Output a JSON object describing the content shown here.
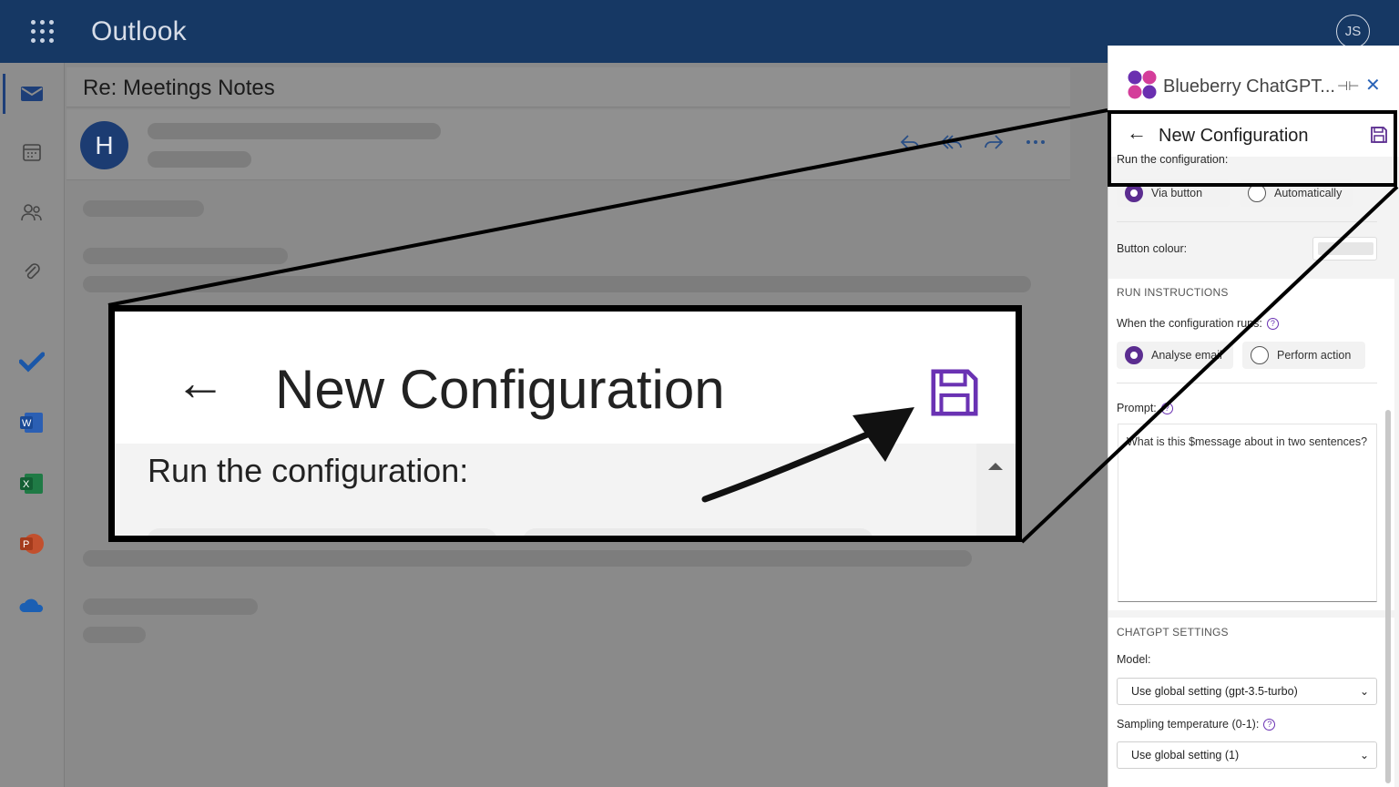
{
  "app": {
    "brand": "Outlook",
    "user_initials": "JS"
  },
  "mail": {
    "subject": "Re: Meetings Notes",
    "sender_initial": "H"
  },
  "panel": {
    "title": "Blueberry ChatGPT...",
    "config_title": "New Configuration",
    "run_label": "Run the configuration:",
    "run_options": [
      "Via button",
      "Automatically"
    ],
    "button_colour_label": "Button colour:",
    "run_instructions_title": "RUN INSTRUCTIONS",
    "when_runs_label": "When the configuration runs:",
    "when_options": [
      "Analyse email",
      "Perform action"
    ],
    "prompt_label": "Prompt:",
    "prompt_value": "What is this $message about in two sentences?",
    "chatgpt_settings_title": "CHATGPT SETTINGS",
    "model_label": "Model:",
    "model_value": "Use global setting (gpt-3.5-turbo)",
    "temperature_label": "Sampling temperature (0-1):",
    "temperature_value": "Use global setting (1)"
  },
  "zoom": {
    "config_title": "New Configuration",
    "run_label": "Run the configuration:"
  },
  "colors": {
    "topbar": "#163864",
    "accent": "#5b2d90",
    "close": "#2a64b8"
  }
}
